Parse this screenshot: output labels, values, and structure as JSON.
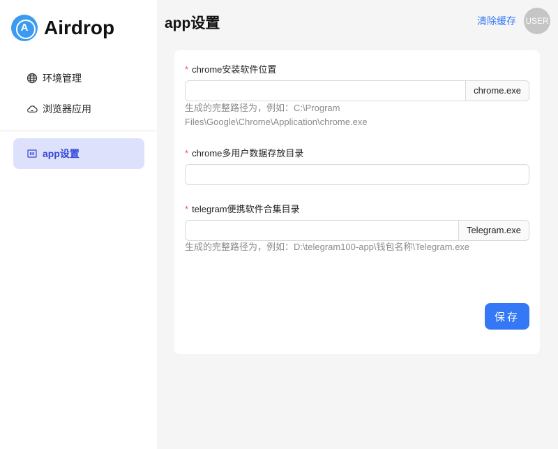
{
  "app": {
    "name": "Airdrop",
    "logo_letter": "A"
  },
  "sidebar": {
    "items": [
      {
        "label": "环境管理",
        "icon": "globe-icon"
      },
      {
        "label": "浏览器应用",
        "icon": "cloud-icon"
      },
      {
        "label": "app设置",
        "icon": "settings-panel-icon",
        "active": true
      }
    ]
  },
  "header": {
    "title": "app设置",
    "clear_cache": "清除缓存",
    "avatar": "USER"
  },
  "form": {
    "chrome_path": {
      "label": "chrome安装软件位置",
      "value": "",
      "addon": "chrome.exe",
      "hint": "生成的完整路径为，例如：C:\\Program Files\\Google\\Chrome\\Application\\chrome.exe"
    },
    "chrome_data": {
      "label": "chrome多用户数据存放目录",
      "value": ""
    },
    "telegram_path": {
      "label": "telegram便携软件合集目录",
      "value": "",
      "addon": "Telegram.exe",
      "hint": "生成的完整路径为，例如：D:\\telegram100-app\\钱包名称\\Telegram.exe"
    },
    "required_mark": "*",
    "save_label": "保存"
  },
  "colors": {
    "primary": "#3478f6",
    "active_nav_bg": "#dde1fb",
    "active_nav_text": "#3346d8",
    "required": "#ff4d4f"
  }
}
